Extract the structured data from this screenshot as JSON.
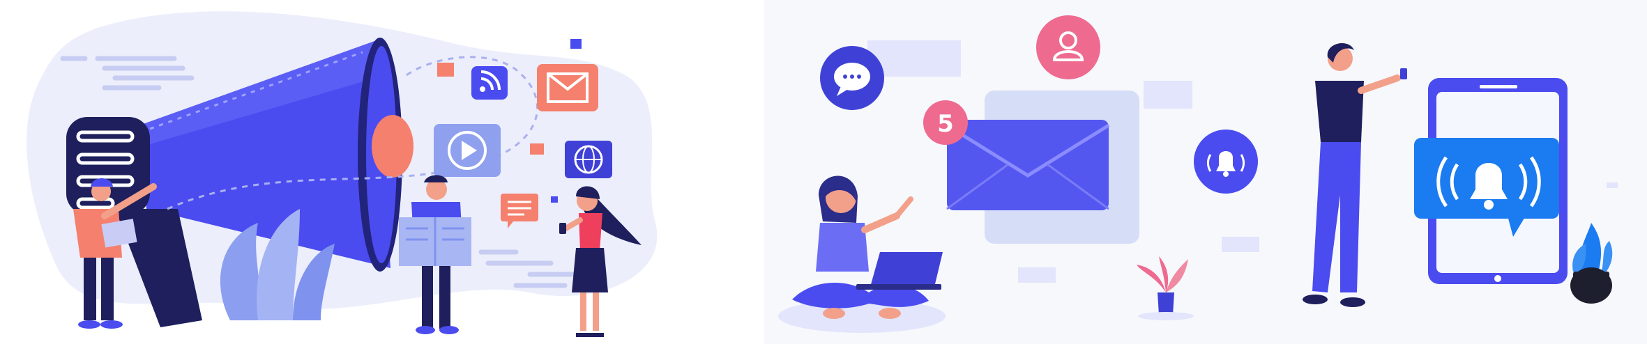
{
  "left_scene": {
    "subject": "megaphone-marketing-illustration",
    "icons": [
      "megaphone-icon",
      "rss-icon",
      "mail-icon",
      "play-icon",
      "globe-icon",
      "chat-icon"
    ]
  },
  "right_scene": {
    "subject": "notifications-illustration",
    "notification_count": "5",
    "icons": [
      "chat-bubble-icon",
      "user-icon",
      "envelope-icon",
      "bell-icon",
      "phone-bell-icon"
    ]
  },
  "colors": {
    "primary_blue": "#4a4cf0",
    "light_blue": "#c9cdf6",
    "pale_bg": "#eef0fb",
    "coral": "#f4806d",
    "pink": "#ee6a8f",
    "dark_navy": "#1e1f5c"
  }
}
